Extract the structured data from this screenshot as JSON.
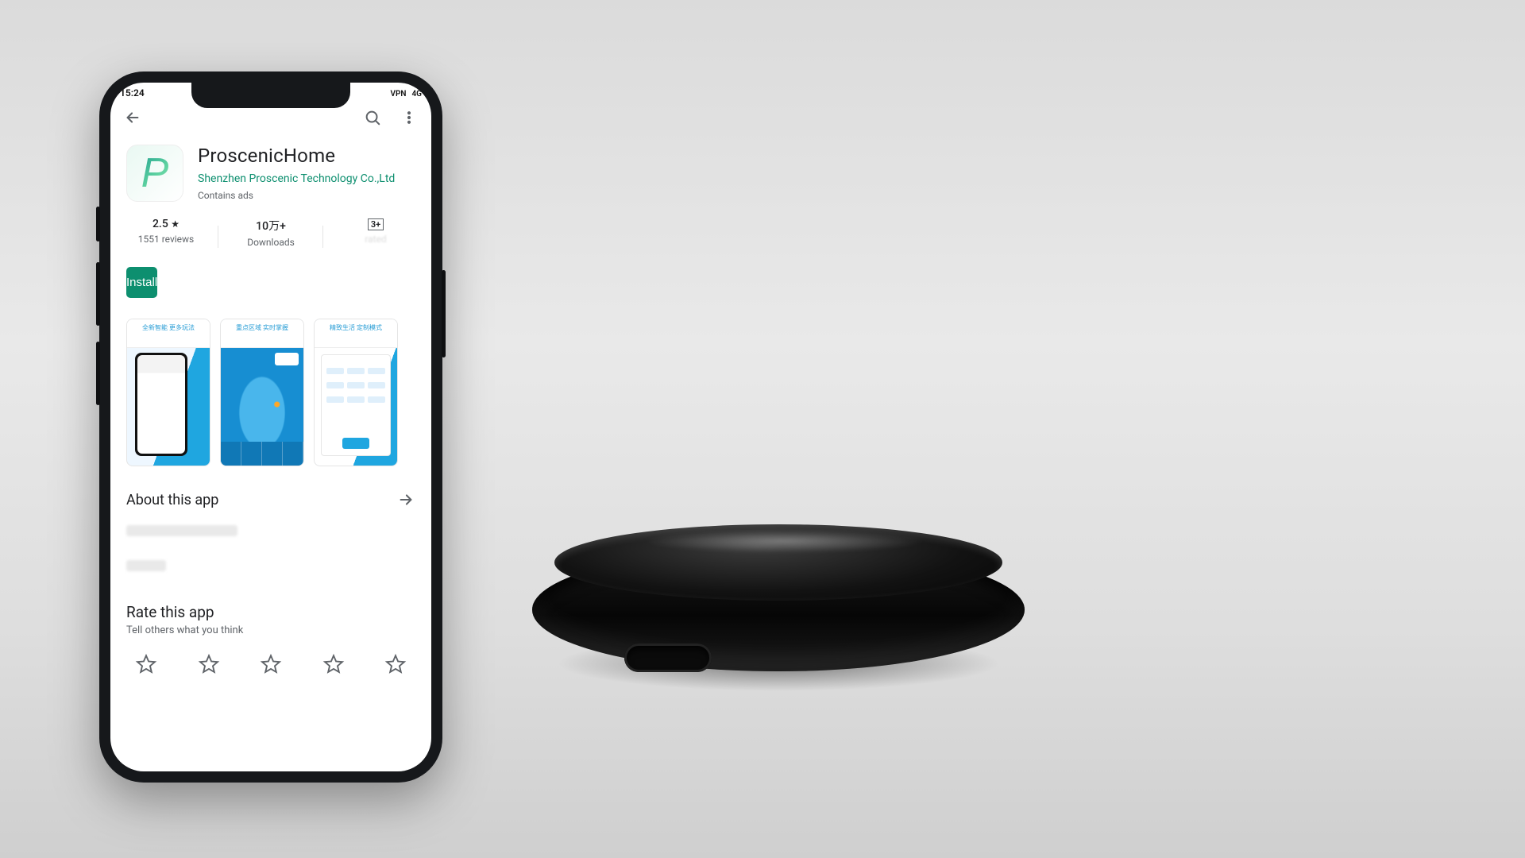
{
  "statusbar": {
    "time": "15:24",
    "vpn": "VPN",
    "net": "4G"
  },
  "app": {
    "name": "ProscenicHome",
    "developer": "Shenzhen Proscenic Technology Co.,Ltd",
    "ads": "Contains ads",
    "icon_letter": "P"
  },
  "stats": {
    "rating_value": "2.5",
    "rating_star": "★",
    "reviews": "1551 reviews",
    "downloads_value": "10万+",
    "downloads_label": "Downloads",
    "age_badge": "3+",
    "age_label_placeholder": "rated"
  },
  "install": {
    "label": "Install"
  },
  "screenshots": {
    "s1_title": "全新智能 更多玩法",
    "s2_title": "重点区域 实时掌握",
    "s3_title": "精致生活 定制模式"
  },
  "about": {
    "title": "About this app"
  },
  "rate": {
    "title": "Rate this app",
    "subtitle": "Tell others what you think"
  }
}
